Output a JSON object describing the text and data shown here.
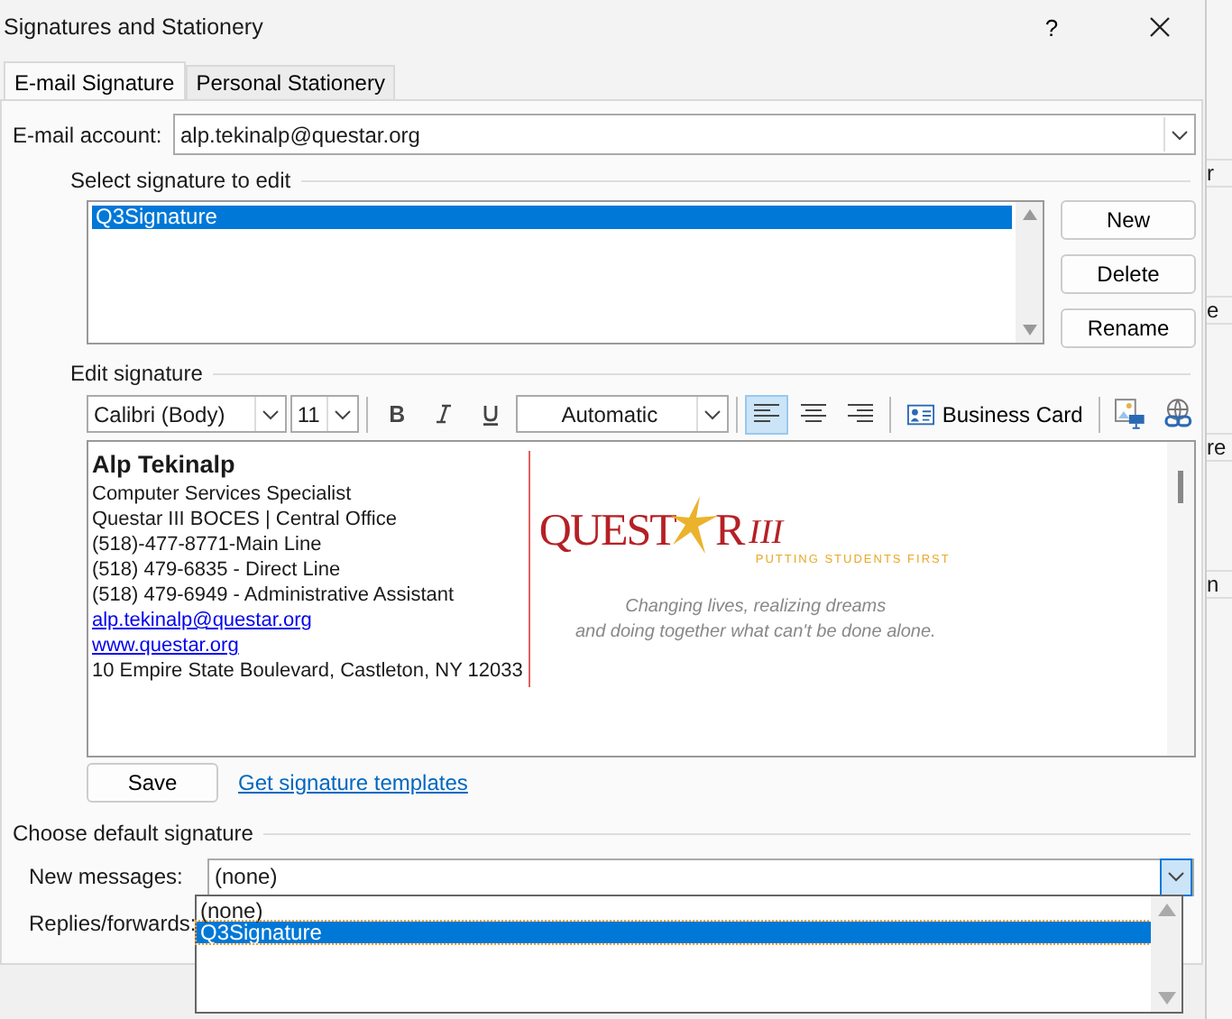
{
  "window": {
    "title": "Signatures and Stationery",
    "help": "?"
  },
  "tabs": [
    {
      "label": "E-mail Signature",
      "selected": true
    },
    {
      "label": "Personal Stationery",
      "selected": false
    }
  ],
  "account": {
    "label": "E-mail account:",
    "value": "alp.tekinalp@questar.org"
  },
  "signature_list": {
    "label": "Select signature to edit",
    "items": [
      {
        "name": "Q3Signature",
        "selected": true
      }
    ]
  },
  "list_buttons": [
    "New",
    "Delete",
    "Rename"
  ],
  "editor": {
    "label": "Edit signature",
    "font": "Calibri (Body)",
    "size": "11",
    "shade": "Automatic",
    "alignments": [
      {
        "kind": "left",
        "selected": true
      },
      {
        "kind": "center",
        "selected": false
      },
      {
        "kind": "right",
        "selected": false
      }
    ],
    "business_card": "Business Card"
  },
  "signature": {
    "name": "Alp Tekinalp",
    "lines": [
      {
        "kind": "text",
        "text": "Computer Services Specialist"
      },
      {
        "kind": "text",
        "text": "Questar III BOCES | Central Office"
      },
      {
        "kind": "text",
        "text": "(518)-477-8771-Main Line"
      },
      {
        "kind": "text",
        "text": "(518) 479-6835 - Direct Line"
      },
      {
        "kind": "text",
        "text": "(518) 479-6949 - Administrative Assistant"
      },
      {
        "kind": "link",
        "text": "alp.tekinalp@questar.org"
      },
      {
        "kind": "link",
        "text": "www.questar.org"
      },
      {
        "kind": "text",
        "text": "10 Empire State Boulevard, Castleton, NY 12033"
      }
    ],
    "logo": {
      "left": "QUEST",
      "right": "R",
      "numeral": "III",
      "tagline": "PUTTING STUDENTS FIRST"
    },
    "motto": [
      "Changing lives, realizing dreams",
      "and doing together what can't be done alone."
    ]
  },
  "save": "Save",
  "templates_link": "Get signature templates",
  "defaults": {
    "label": "Choose default signature",
    "new_messages": {
      "label": "New messages:",
      "value": "(none)"
    },
    "replies": {
      "label": "Replies/forwards:"
    }
  },
  "dropdown": {
    "items": [
      {
        "name": "(none)",
        "selected": false
      },
      {
        "name": "Q3Signature",
        "selected": true
      }
    ]
  },
  "background_fragments": [
    "r",
    "e",
    "re",
    "n"
  ]
}
